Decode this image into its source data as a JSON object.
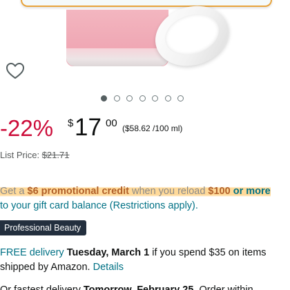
{
  "colors": {
    "discount_red": "#cc0c39",
    "link_teal": "#007185",
    "credit_orange": "#b1602a",
    "highlight": "#ffcd78",
    "badge_bg": "#232f3e"
  },
  "product_image": {
    "wishlist_icon": "heart-outline-icon",
    "carousel": {
      "total": 7,
      "active_index": 0
    }
  },
  "price": {
    "discount": "-22%",
    "currency": "$",
    "whole": "17",
    "fraction": "00",
    "unit_price": "($58.62 /100 ml)"
  },
  "list_price": {
    "label": "List Price:",
    "value": "$21.71"
  },
  "promo": {
    "part1": "Get a ",
    "credit": "$6 promotional credit",
    "part2": " when you reload ",
    "amount": "$100",
    "or_more": " or more",
    "part3": " to your gift card balance (Restrictions apply)."
  },
  "badge": {
    "label": "Professional Beauty"
  },
  "delivery": {
    "free": "FREE delivery",
    "date": "Tuesday, March 1",
    "condition": " if you spend $35 on items shipped by Amazon. ",
    "details": "Details"
  },
  "fastest": {
    "prefix": "Or fastest delivery ",
    "date": "Tomorrow, February 25",
    "suffix": ". Order within"
  }
}
